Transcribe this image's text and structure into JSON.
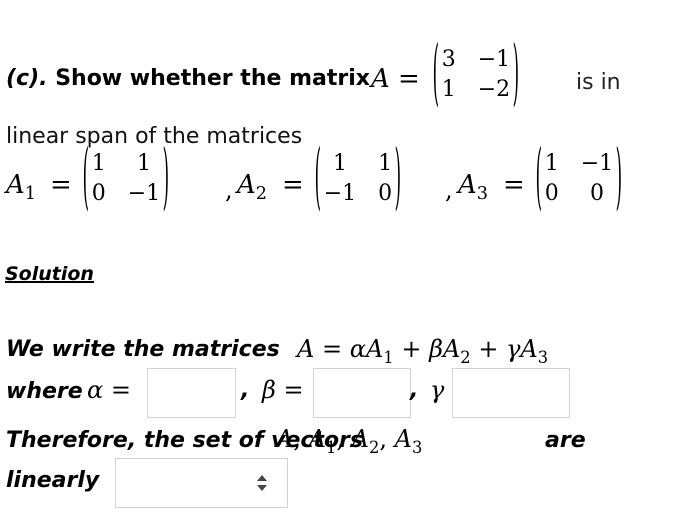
{
  "question": {
    "label": "(c).",
    "text_bold_1": "Show whether the matrix",
    "matrix_name": "A",
    "equals": "=",
    "matrix_A": [
      [
        "3",
        "−1"
      ],
      [
        "1",
        "−2"
      ]
    ],
    "text_after": "is in",
    "line2": "linear span of the matrices",
    "matrices": [
      {
        "name": "A",
        "sub": "1",
        "values": [
          [
            "1",
            "1"
          ],
          [
            "0",
            "−1"
          ]
        ]
      },
      {
        "name": "A",
        "sub": "2",
        "values": [
          [
            "1",
            "1"
          ],
          [
            "−1",
            "0"
          ]
        ]
      },
      {
        "name": "A",
        "sub": "3",
        "values": [
          [
            "1",
            "−1"
          ],
          [
            "0",
            "0"
          ]
        ]
      }
    ],
    "separator": ","
  },
  "solution": {
    "heading": "Solution",
    "line1_text": "We write the matrices",
    "equation": {
      "lhs": "A",
      "eq": "=",
      "terms": [
        {
          "coef": "α",
          "var": "A",
          "sub": "1"
        },
        {
          "op": "+",
          "coef": "β",
          "var": "A",
          "sub": "2"
        },
        {
          "op": "+",
          "coef": "γ",
          "var": "A",
          "sub": "3"
        }
      ]
    },
    "where_text": "where",
    "alpha_label": "α",
    "beta_label": "β",
    "gamma_label": "γ",
    "eq_sign": "=",
    "comma": ",",
    "alpha_value": "",
    "beta_value": "",
    "gamma_value": "",
    "conclusion_text": "Therefore, the set of vectors",
    "vectors": [
      {
        "name": "A",
        "sub": ""
      },
      {
        "name": "A",
        "sub": "1"
      },
      {
        "name": "A",
        "sub": "2"
      },
      {
        "name": "A",
        "sub": "3"
      }
    ],
    "are_text": "are",
    "linearly_text": "linearly",
    "dependency_select": {
      "selected": "",
      "icon": "up-down-arrows-icon"
    }
  }
}
